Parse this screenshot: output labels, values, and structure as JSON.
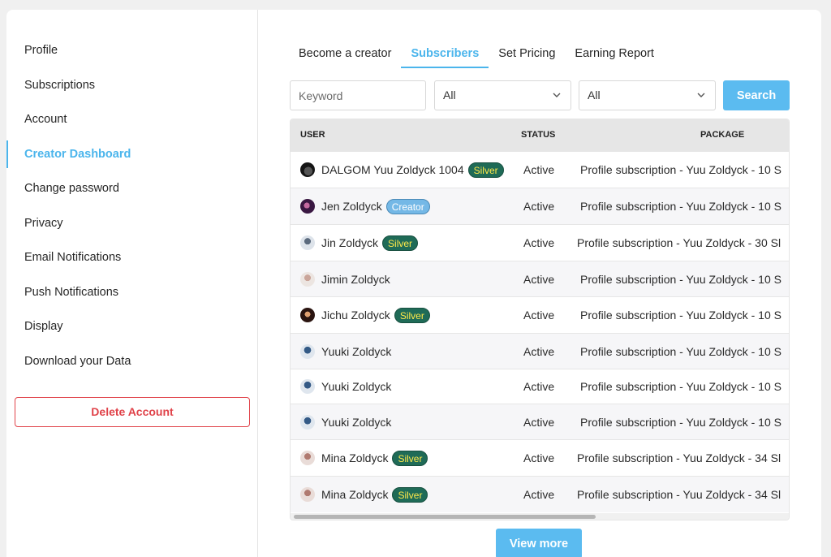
{
  "sidebar": {
    "items": [
      {
        "label": "Profile"
      },
      {
        "label": "Subscriptions"
      },
      {
        "label": "Account"
      },
      {
        "label": "Creator Dashboard"
      },
      {
        "label": "Change password"
      },
      {
        "label": "Privacy"
      },
      {
        "label": "Email Notifications"
      },
      {
        "label": "Push Notifications"
      },
      {
        "label": "Display"
      },
      {
        "label": "Download your Data"
      }
    ],
    "active_index": 3,
    "delete_label": "Delete Account"
  },
  "tabs": [
    {
      "label": "Become a creator"
    },
    {
      "label": "Subscribers"
    },
    {
      "label": "Set Pricing"
    },
    {
      "label": "Earning Report"
    }
  ],
  "active_tab": 1,
  "filters": {
    "keyword_placeholder": "Keyword",
    "select1_value": "All",
    "select2_value": "All",
    "search_label": "Search"
  },
  "table": {
    "headers": {
      "user": "USER",
      "status": "STATUS",
      "package": "PACKAGE"
    },
    "rows": [
      {
        "name": "DALGOM Yuu Zoldyck 1004",
        "badge": "Silver",
        "status": "Active",
        "package": "Profile subscription - Yuu Zoldyck - 10 S"
      },
      {
        "name": "Jen Zoldyck",
        "badge": "Creator",
        "status": "Active",
        "package": "Profile subscription - Yuu Zoldyck - 10 S"
      },
      {
        "name": "Jin Zoldyck",
        "badge": "Silver",
        "status": "Active",
        "package": "Profile subscription - Yuu Zoldyck - 30 Sl"
      },
      {
        "name": "Jimin Zoldyck",
        "badge": "",
        "status": "Active",
        "package": "Profile subscription - Yuu Zoldyck - 10 S"
      },
      {
        "name": "Jichu Zoldyck",
        "badge": "Silver",
        "status": "Active",
        "package": "Profile subscription - Yuu Zoldyck - 10 S"
      },
      {
        "name": "Yuuki Zoldyck",
        "badge": "",
        "status": "Active",
        "package": "Profile subscription - Yuu Zoldyck - 10 S"
      },
      {
        "name": "Yuuki Zoldyck",
        "badge": "",
        "status": "Active",
        "package": "Profile subscription - Yuu Zoldyck - 10 S"
      },
      {
        "name": "Yuuki Zoldyck",
        "badge": "",
        "status": "Active",
        "package": "Profile subscription - Yuu Zoldyck - 10 S"
      },
      {
        "name": "Mina Zoldyck",
        "badge": "Silver",
        "status": "Active",
        "package": "Profile subscription - Yuu Zoldyck - 34 Sl"
      },
      {
        "name": "Mina Zoldyck",
        "badge": "Silver",
        "status": "Active",
        "package": "Profile subscription - Yuu Zoldyck - 34 Sl"
      }
    ]
  },
  "view_more_label": "View more",
  "colors": {
    "accent": "#4bb5ec",
    "button": "#5bbbf0",
    "danger": "#e0434a",
    "badge_silver_bg": "#1f6b57",
    "badge_silver_text": "#ffe94a",
    "badge_creator_bg": "#74b8e6"
  }
}
